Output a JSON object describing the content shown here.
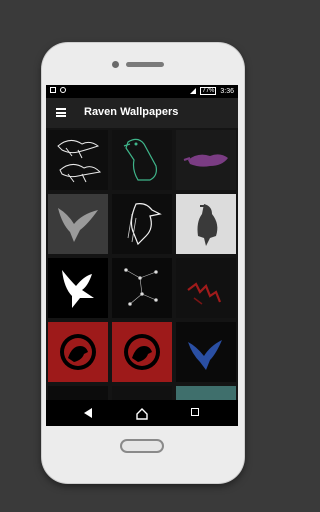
{
  "status_bar": {
    "battery": "77%",
    "time": "3:36"
  },
  "toolbar": {
    "title": "Raven Wallpapers"
  },
  "wallpapers": [
    {
      "name": "two-birds-line-art",
      "bg": "#0e0e0e"
    },
    {
      "name": "green-neon-raven",
      "bg": "#111111"
    },
    {
      "name": "purple-raven",
      "bg": "#1a1a1a"
    },
    {
      "name": "grey-flying-raven",
      "bg": "#3b3b3b"
    },
    {
      "name": "black-white-raven-sketch",
      "bg": "#0d0d0d"
    },
    {
      "name": "raven-on-white",
      "bg": "#d9d9d9"
    },
    {
      "name": "white-flying-bird",
      "bg": "#000000"
    },
    {
      "name": "constellation-raven",
      "bg": "#0a0a0a"
    },
    {
      "name": "red-claw-raven",
      "bg": "#111111"
    },
    {
      "name": "red-circle-raven-logo",
      "bg": "#9e1a1a"
    },
    {
      "name": "red-circle-raven-logo-2",
      "bg": "#9e1a1a"
    },
    {
      "name": "blue-raven",
      "bg": "#0a0a0a"
    },
    {
      "name": "partial-wallpaper-1",
      "bg": "#0c0c0c"
    },
    {
      "name": "partial-wallpaper-2",
      "bg": "#111111"
    },
    {
      "name": "partial-wallpaper-3",
      "bg": "#3f6f6c"
    }
  ],
  "nav": {
    "back_icon": "back-triangle-icon",
    "home_icon": "home-house-icon",
    "recent_icon": "recent-square-icon"
  }
}
